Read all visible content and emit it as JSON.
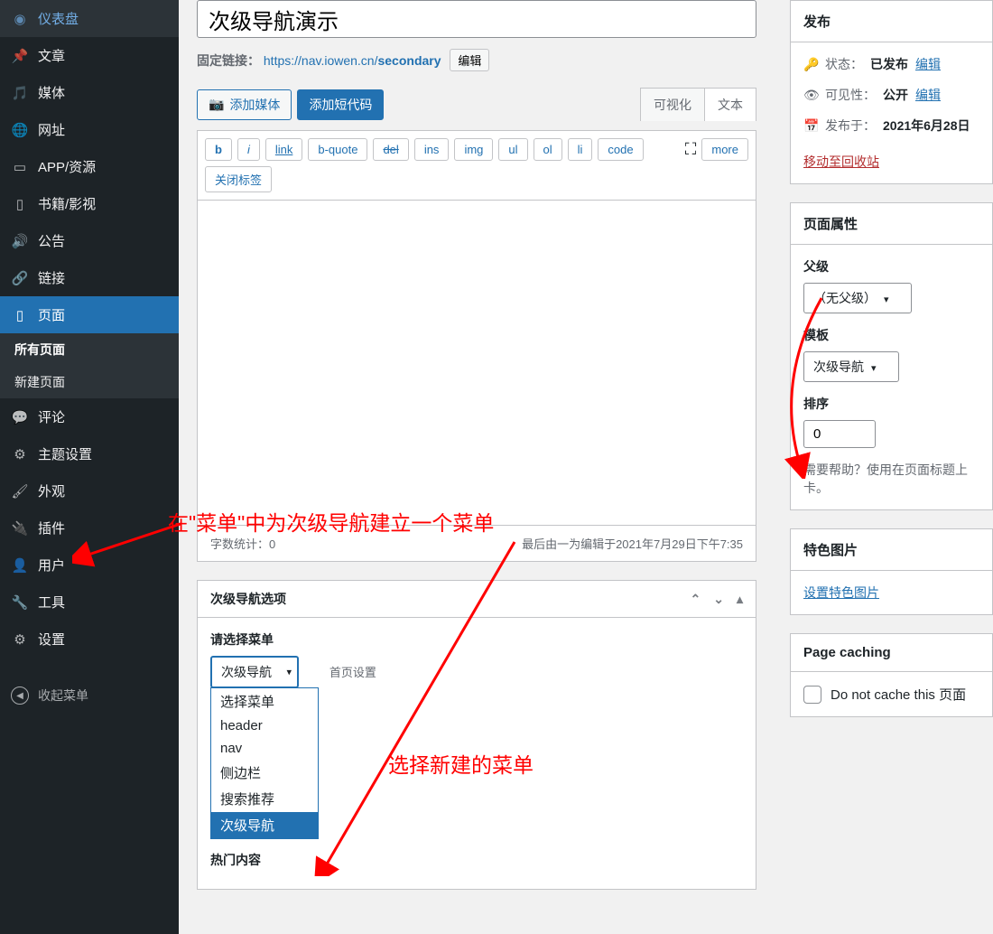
{
  "sidebar": {
    "items": [
      {
        "label": "仪表盘",
        "icon": "dashboard"
      },
      {
        "label": "文章",
        "icon": "pin"
      },
      {
        "label": "媒体",
        "icon": "media"
      },
      {
        "label": "网址",
        "icon": "globe"
      },
      {
        "label": "APP/资源",
        "icon": "archive"
      },
      {
        "label": "书籍/影视",
        "icon": "book"
      },
      {
        "label": "公告",
        "icon": "megaphone"
      },
      {
        "label": "链接",
        "icon": "link"
      },
      {
        "label": "页面",
        "icon": "page",
        "active": true
      },
      {
        "label": "评论",
        "icon": "comment"
      },
      {
        "label": "主题设置",
        "icon": "gear"
      },
      {
        "label": "外观",
        "icon": "brush"
      },
      {
        "label": "插件",
        "icon": "plug"
      },
      {
        "label": "用户",
        "icon": "user"
      },
      {
        "label": "工具",
        "icon": "wrench"
      },
      {
        "label": "设置",
        "icon": "sliders"
      }
    ],
    "submenu": [
      {
        "label": "所有页面",
        "current": true
      },
      {
        "label": "新建页面"
      }
    ],
    "collapse": "收起菜单"
  },
  "editor": {
    "title": "次级导航演示",
    "permalink_label": "固定链接：",
    "permalink_base": "https://nav.iowen.cn/",
    "permalink_slug": "secondary",
    "edit_slug": "编辑",
    "add_media": "添加媒体",
    "add_shortcode": "添加短代码",
    "tab_visual": "可视化",
    "tab_text": "文本",
    "buttons": [
      "b",
      "i",
      "link",
      "b-quote",
      "del",
      "ins",
      "img",
      "ul",
      "ol",
      "li",
      "code",
      "more",
      "关闭标签"
    ],
    "word_count_label": "字数统计：",
    "word_count": "0",
    "last_edit": "最后由一为编辑于2021年7月29日下午7:35"
  },
  "secondary_box": {
    "title": "次级导航选项",
    "select_label": "请选择菜单",
    "selected": "次级导航",
    "options": [
      "选择菜单",
      "header",
      "nav",
      "侧边栏",
      "搜索推荐",
      "次级导航"
    ],
    "helper": "首页设置",
    "hot_title": "热门内容"
  },
  "publish": {
    "title": "发布",
    "status_label": "状态：",
    "status_val": "已发布",
    "edit": "编辑",
    "visibility_label": "可见性：",
    "visibility_val": "公开",
    "publish_label": "发布于：",
    "publish_val": "2021年6月28日",
    "trash": "移动至回收站"
  },
  "page_attr": {
    "title": "页面属性",
    "parent_label": "父级",
    "parent_val": "（无父级）",
    "template_label": "模板",
    "template_val": "次级导航",
    "order_label": "排序",
    "order_val": "0",
    "help": "需要帮助？使用在页面标题上卡。"
  },
  "featured": {
    "title": "特色图片",
    "link": "设置特色图片"
  },
  "caching": {
    "title": "Page caching",
    "checkbox": "Do not cache this 页面"
  },
  "annotations": {
    "a1": "在\"菜单\"中为次级导航建立一个菜单",
    "a2": "选择新建的菜单"
  }
}
